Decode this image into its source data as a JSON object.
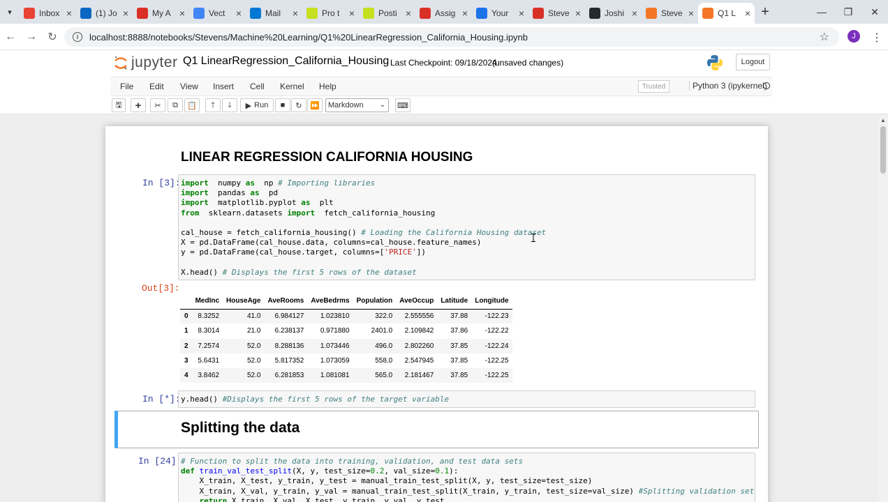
{
  "browser": {
    "tabs": [
      {
        "label": "Inbox",
        "icon": "gmail-icon",
        "color": "#ea4335"
      },
      {
        "label": "(1) Jo",
        "icon": "linkedin-icon",
        "color": "#0a66c2"
      },
      {
        "label": "My A",
        "icon": "app-icon",
        "color": "#d93025"
      },
      {
        "label": "Vect",
        "icon": "vector-icon",
        "color": "#4285f4"
      },
      {
        "label": "Mail",
        "icon": "outlook-icon",
        "color": "#0078d4"
      },
      {
        "label": "Pro t",
        "icon": "hash-icon",
        "color": "#c6e01f"
      },
      {
        "label": "Posti",
        "icon": "hash-icon",
        "color": "#c6e01f"
      },
      {
        "label": "Assig",
        "icon": "settings-icon",
        "color": "#d93025"
      },
      {
        "label": "Your",
        "icon": "chart-icon",
        "color": "#1a73e8"
      },
      {
        "label": "Steve",
        "icon": "app-icon",
        "color": "#d93025"
      },
      {
        "label": "Joshi",
        "icon": "github-icon",
        "color": "#24292e"
      },
      {
        "label": "Steve",
        "icon": "jupyter-icon",
        "color": "#f37726"
      },
      {
        "label": "Q1 L",
        "icon": "jupyter-icon",
        "color": "#f37726"
      }
    ],
    "url": "localhost:8888/notebooks/Stevens/Machine%20Learning/Q1%20LinearRegression_California_Housing.ipynb",
    "profile_initial": "J"
  },
  "jupyter": {
    "logo_text": "jupyter",
    "notebook_name": "Q1 LinearRegression_California_Housing",
    "checkpoint": "Last Checkpoint: 09/18/2024",
    "unsaved": "(unsaved changes)",
    "logout": "Logout",
    "menu": [
      "File",
      "Edit",
      "View",
      "Insert",
      "Cell",
      "Kernel",
      "Help"
    ],
    "trusted": "Trusted",
    "kernel": "Python 3 (ipykernel)",
    "toolbar": {
      "run": "Run",
      "cell_type": "Markdown"
    }
  },
  "notebook": {
    "title": "LINEAR REGRESSION CALIFORNIA HOUSING",
    "cell1_prompt": "In [3]:",
    "cell1_out_prompt": "Out[3]:",
    "cell1_code": [
      [
        [
          "kw",
          "import"
        ],
        [
          "",
          "  numpy "
        ],
        [
          "kw",
          "as"
        ],
        [
          "",
          "  np "
        ],
        [
          "cm",
          "# Importing libraries"
        ]
      ],
      [
        [
          "kw",
          "import"
        ],
        [
          "",
          "  pandas "
        ],
        [
          "kw",
          "as"
        ],
        [
          "",
          "  pd"
        ]
      ],
      [
        [
          "kw",
          "import"
        ],
        [
          "",
          "  matplotlib.pyplot "
        ],
        [
          "kw",
          "as"
        ],
        [
          "",
          "  plt"
        ]
      ],
      [
        [
          "kw",
          "from"
        ],
        [
          "",
          "  sklearn.datasets "
        ],
        [
          "kw",
          "import"
        ],
        [
          "",
          "  fetch_california_housing"
        ]
      ],
      [
        [
          "",
          ""
        ]
      ],
      [
        [
          "",
          "cal_house = fetch_california_housing() "
        ],
        [
          "cm",
          "# Loading the California Housing dataset"
        ]
      ],
      [
        [
          "",
          "X = pd.DataFrame(cal_house.data, columns=cal_house.feature_names)"
        ]
      ],
      [
        [
          "",
          "y = pd.DataFrame(cal_house.target, columns=["
        ],
        [
          "st",
          "'PRICE'"
        ],
        [
          "",
          "])"
        ]
      ],
      [
        [
          "",
          ""
        ]
      ],
      [
        [
          "",
          "X.head() "
        ],
        [
          "cm",
          "# Displays the first 5 rows of the dataset"
        ]
      ]
    ],
    "table": {
      "columns": [
        "",
        "MedInc",
        "HouseAge",
        "AveRooms",
        "AveBedrms",
        "Population",
        "AveOccup",
        "Latitude",
        "Longitude"
      ],
      "rows": [
        [
          "0",
          "8.3252",
          "41.0",
          "6.984127",
          "1.023810",
          "322.0",
          "2.555556",
          "37.88",
          "-122.23"
        ],
        [
          "1",
          "8.3014",
          "21.0",
          "6.238137",
          "0.971880",
          "2401.0",
          "2.109842",
          "37.86",
          "-122.22"
        ],
        [
          "2",
          "7.2574",
          "52.0",
          "8.288136",
          "1.073446",
          "496.0",
          "2.802260",
          "37.85",
          "-122.24"
        ],
        [
          "3",
          "5.6431",
          "52.0",
          "5.817352",
          "1.073059",
          "558.0",
          "2.547945",
          "37.85",
          "-122.25"
        ],
        [
          "4",
          "3.8462",
          "52.0",
          "6.281853",
          "1.081081",
          "565.0",
          "2.181467",
          "37.85",
          "-122.25"
        ]
      ]
    },
    "cell2_prompt": "In [*]:",
    "cell2_code": [
      [
        [
          "",
          "y.head() "
        ],
        [
          "cm",
          "#Displays the first 5 rows of the target variable"
        ]
      ]
    ],
    "section_heading": "Splitting the data",
    "cell3_prompt": "In [24]:",
    "cell3_code": [
      [
        [
          "cm",
          "# Function to split the data into training, validation, and test data sets"
        ]
      ],
      [
        [
          "kw",
          "def"
        ],
        [
          "",
          " "
        ],
        [
          "fn",
          "train_val_test_split"
        ],
        [
          "",
          "(X, y, test_size="
        ],
        [
          "nm",
          "0.2"
        ],
        [
          "",
          ", val_size="
        ],
        [
          "nm",
          "0.1"
        ],
        [
          "",
          "):"
        ]
      ],
      [
        [
          "",
          "    X_train, X_test, y_train, y_test = manual_train_test_split(X, y, test_size=test_size)"
        ]
      ],
      [
        [
          "",
          "    X_train, X_val, y_train, y_val = manual_train_test_split(X_train, y_train, test_size=val_size) "
        ],
        [
          "cm",
          "#Splitting validation set"
        ]
      ],
      [
        [
          "",
          "    "
        ],
        [
          "kw",
          "return"
        ],
        [
          "",
          " X_train, X_val, X_test, y_train, y_val, y_test"
        ]
      ]
    ]
  }
}
